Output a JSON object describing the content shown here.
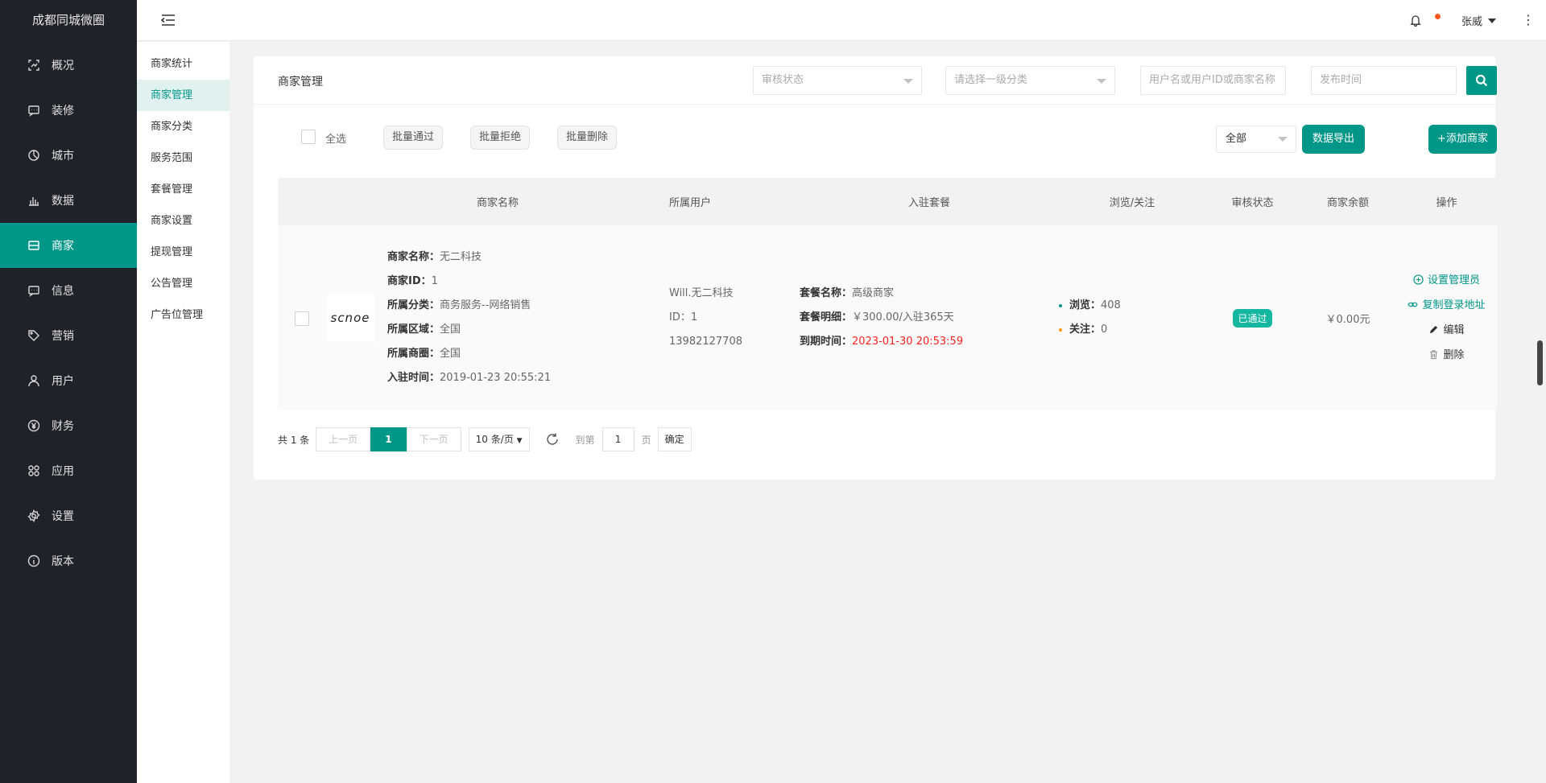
{
  "app": {
    "title": "成都同城微圈"
  },
  "sidebar": {
    "items": [
      {
        "label": "概况",
        "icon": "dashboard-icon"
      },
      {
        "label": "装修",
        "icon": "chat-icon"
      },
      {
        "label": "城市",
        "icon": "pie-icon"
      },
      {
        "label": "数据",
        "icon": "bar-chart-icon"
      },
      {
        "label": "商家",
        "icon": "store-icon",
        "active": true
      },
      {
        "label": "信息",
        "icon": "message-icon"
      },
      {
        "label": "营销",
        "icon": "tag-icon"
      },
      {
        "label": "用户",
        "icon": "user-icon"
      },
      {
        "label": "财务",
        "icon": "yen-icon"
      },
      {
        "label": "应用",
        "icon": "apps-icon"
      },
      {
        "label": "设置",
        "icon": "settings-icon"
      },
      {
        "label": "版本",
        "icon": "info-icon"
      }
    ]
  },
  "subnav": {
    "items": [
      {
        "label": "商家统计"
      },
      {
        "label": "商家管理",
        "active": true
      },
      {
        "label": "商家分类"
      },
      {
        "label": "服务范围"
      },
      {
        "label": "套餐管理"
      },
      {
        "label": "商家设置"
      },
      {
        "label": "提现管理"
      },
      {
        "label": "公告管理"
      },
      {
        "label": "广告位管理"
      }
    ]
  },
  "header": {
    "username": "张威",
    "has_notification": true
  },
  "card": {
    "title": "商家管理",
    "filters": {
      "audit_status_placeholder": "审核状态",
      "category_placeholder": "请选择一级分类",
      "keyword_placeholder": "用户名或用户ID或商家名称",
      "publish_time_placeholder": "发布时间"
    },
    "toolbar": {
      "select_all": "全选",
      "batch_approve": "批量通过",
      "batch_reject": "批量拒绝",
      "batch_delete": "批量删除",
      "scope_value": "全部",
      "export": "数据导出",
      "add": "+添加商家"
    }
  },
  "table": {
    "headers": {
      "name": "商家名称",
      "user": "所属用户",
      "package": "入驻套餐",
      "views": "浏览/关注",
      "status": "审核状态",
      "balance": "商家余额",
      "actions": "操作"
    },
    "rows": [
      {
        "logo_text": "scnoe",
        "info": [
          {
            "k": "商家名称：",
            "v": "无二科技"
          },
          {
            "k": "商家ID：",
            "v": "1"
          },
          {
            "k": "所属分类：",
            "v": "商务服务--网络销售"
          },
          {
            "k": "所属区域：",
            "v": "全国"
          },
          {
            "k": "所属商圈：",
            "v": "全国"
          },
          {
            "k": "入驻时间：",
            "v": "2019-01-23 20:55:21"
          }
        ],
        "user": {
          "name": "Will.无二科技",
          "id": "ID：1",
          "phone": "13982127708"
        },
        "package": {
          "name_k": "套餐名称：",
          "name_v": "高级商家",
          "detail_k": "套餐明细：",
          "detail_v": "￥300.00/入驻365天",
          "expire_k": "到期时间：",
          "expire_v": "2023-01-30 20:53:59"
        },
        "stats": {
          "views_k": "浏览：",
          "views_v": "408",
          "follow_k": "关注：",
          "follow_v": "0"
        },
        "status": "已通过",
        "balance": "￥0.00元",
        "actions": {
          "set_admin": "设置管理员",
          "copy_login": "复制登录地址",
          "edit": "编辑",
          "delete": "删除"
        }
      }
    ]
  },
  "pagination": {
    "total": "共 1 条",
    "prev": "上一页",
    "current": "1",
    "next": "下一页",
    "limit": "10 条/页",
    "goto": "到第",
    "page_input": "1",
    "page_unit": "页",
    "confirm": "确定"
  },
  "colors": {
    "accent": "#009688",
    "sidebar_bg": "#20222a",
    "expire_red": "#ff2222",
    "badge": "#16b7a0"
  }
}
